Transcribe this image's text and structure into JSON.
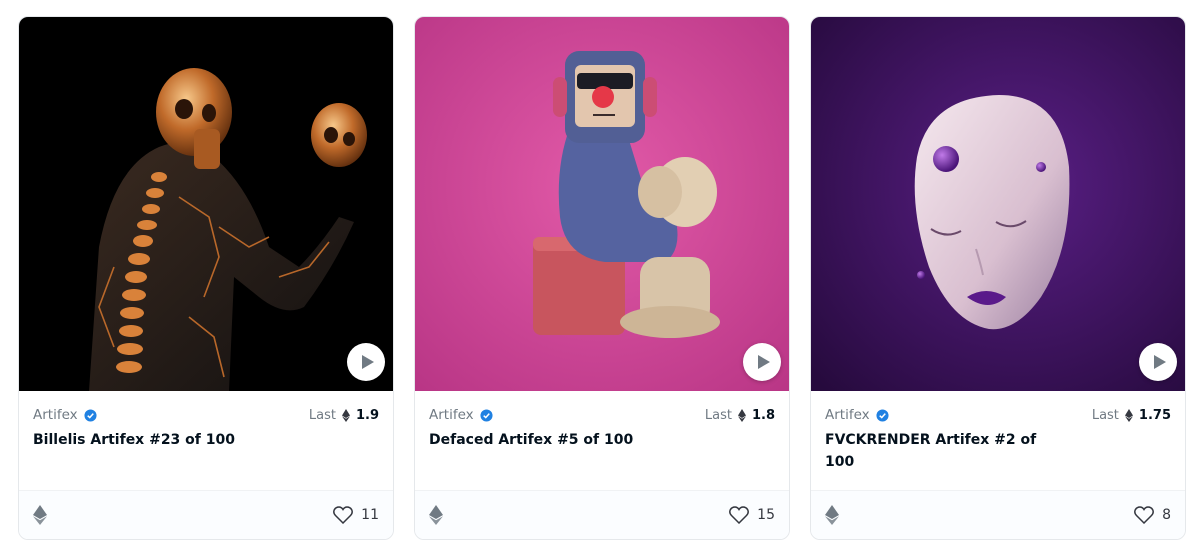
{
  "colors": {
    "accent_blue": "#2081e2",
    "text_primary": "#04111d",
    "text_secondary": "#707a83"
  },
  "cards": [
    {
      "collection": "Artifex",
      "last_label": "Last",
      "last_price": "1.9",
      "title": "Billelis Artifex #23 of 100",
      "likes": "11",
      "media_icon": "play-icon",
      "chain_icon": "ethereum-icon"
    },
    {
      "collection": "Artifex",
      "last_label": "Last",
      "last_price": "1.8",
      "title": "Defaced Artifex #5 of 100",
      "likes": "15",
      "media_icon": "play-icon",
      "chain_icon": "ethereum-icon"
    },
    {
      "collection": "Artifex",
      "last_label": "Last",
      "last_price": "1.75",
      "title": "FVCKRENDER Artifex #2 of 100",
      "likes": "8",
      "media_icon": "play-icon",
      "chain_icon": "ethereum-icon"
    }
  ]
}
